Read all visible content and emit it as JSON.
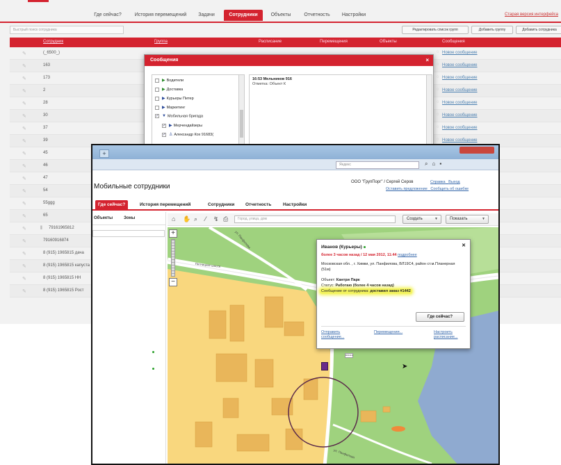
{
  "background_app": {
    "tabs": [
      {
        "label": "Где сейчас?",
        "active": false
      },
      {
        "label": "История перемещений",
        "active": false
      },
      {
        "label": "Задачи",
        "active": false
      },
      {
        "label": "Сотрудники",
        "active": true
      },
      {
        "label": "Объекты",
        "active": false
      },
      {
        "label": "Отчетность",
        "active": false
      },
      {
        "label": "Настройки",
        "active": false
      }
    ],
    "old_version_link": "Старая версия интерфейса",
    "search_placeholder": "Быстрый поиск сотрудника",
    "buttons": {
      "edit_groups": "Редактировать список групп",
      "add_group": "Добавить группу",
      "add_employee": "Добавить сотрудника"
    },
    "columns": [
      "Сотрудник",
      "Группа",
      "Расписание",
      "Перемещения",
      "Объекты",
      "Сообщения"
    ],
    "rows": [
      {
        "name": "(_6500_)",
        "pinned": false
      },
      {
        "name": "163",
        "pinned": false
      },
      {
        "name": "173",
        "pinned": false
      },
      {
        "name": "2",
        "pinned": false
      },
      {
        "name": "28",
        "pinned": false
      },
      {
        "name": "30",
        "pinned": false
      },
      {
        "name": "37",
        "pinned": false
      },
      {
        "name": "39",
        "pinned": false
      },
      {
        "name": "45",
        "pinned": false
      },
      {
        "name": "46",
        "pinned": false
      },
      {
        "name": "47",
        "pinned": false
      },
      {
        "name": "54",
        "pinned": false
      },
      {
        "name": "55ggg",
        "pinned": false
      },
      {
        "name": "65",
        "pinned": false
      },
      {
        "name": "79161965812",
        "pinned": true
      },
      {
        "name": "79160916874",
        "pinned": false
      },
      {
        "name": "8 (915) 1965815 дача",
        "pinned": false
      },
      {
        "name": "8 (915) 1965815 капуста",
        "pinned": false
      },
      {
        "name": "8 (915) 1965815 НН",
        "pinned": false
      },
      {
        "name": "8 (915) 1965815 Рост",
        "pinned": false
      }
    ],
    "new_message_label": "Новое сообщение"
  },
  "messages_dialog": {
    "title": "Сообщения",
    "tree": [
      {
        "label": "Водители",
        "checked": false,
        "expanded": false
      },
      {
        "label": "Доставка",
        "checked": false,
        "expanded": false
      },
      {
        "label": "Курьеры Питер",
        "checked": false,
        "expanded": false
      },
      {
        "label": "Маркетинг",
        "checked": false,
        "expanded": false
      },
      {
        "label": "Мобильная бригада",
        "checked": true,
        "expanded": true
      },
      {
        "label": "Мерчендайзеры",
        "checked": true,
        "expanded": false
      },
      {
        "label": "Александр Кох 91683(",
        "checked": true,
        "expanded": false
      }
    ],
    "message_header": "16:53 Мельников 916",
    "message_body": "Отметка: Объект К"
  },
  "browser": {
    "address_placeholder": "Яндекс",
    "page_title": "Мобильные сотрудники",
    "account": "ООО \"ГрупПорг\" / Сергей Серов",
    "links_top": [
      "Справка",
      "Выход"
    ],
    "links_bottom": [
      "Оставить предложение",
      "Сообщить об ошибке"
    ],
    "nav_tabs": [
      {
        "label": "Где сейчас?",
        "active": true
      },
      {
        "label": "История перемещений",
        "active": false
      },
      {
        "label": "Сотрудники",
        "active": false
      },
      {
        "label": "Отчетность",
        "active": false
      },
      {
        "label": "Настройки",
        "active": false
      }
    ],
    "left_tabs": [
      "Объекты",
      "Зоны"
    ],
    "map_search_placeholder": "Город, улица, дом",
    "create_button": "Создать",
    "show_button": "Показать",
    "road_labels": [
      "Пятницкое шоссе",
      "ул. Панфилова",
      "ул. Панфилова"
    ],
    "popup": {
      "title": "Иванов (Курьеры)",
      "time": "более 3 часов назад / 12 мая 2012, 11:44",
      "time_link": "подробнее",
      "address": "Московская обл. , г. Химки, ул. Панфилова, ВЛ19С4, район ст.м.Планерная (51м)",
      "object_label": "Объект:",
      "object_value": "Кантри Парк",
      "status_label": "Статус:",
      "status_value": "Работаю (более 4 часов назад)",
      "message_label": "Сообщение от сотрудника:",
      "message_value": "доставил заказ #1442",
      "where_button": "Где сейчас?",
      "links": [
        "Отправить сообщение...",
        "Перемещения...",
        "Настроить расписание..."
      ]
    },
    "marker_tag": "ВЛ19С4"
  },
  "colors": {
    "brand_red": "#d4232f",
    "map_green": "#9fd27e",
    "map_yellow": "#f9d77e",
    "map_water": "#8faad0",
    "highlight_yellow": "#f0f028"
  }
}
